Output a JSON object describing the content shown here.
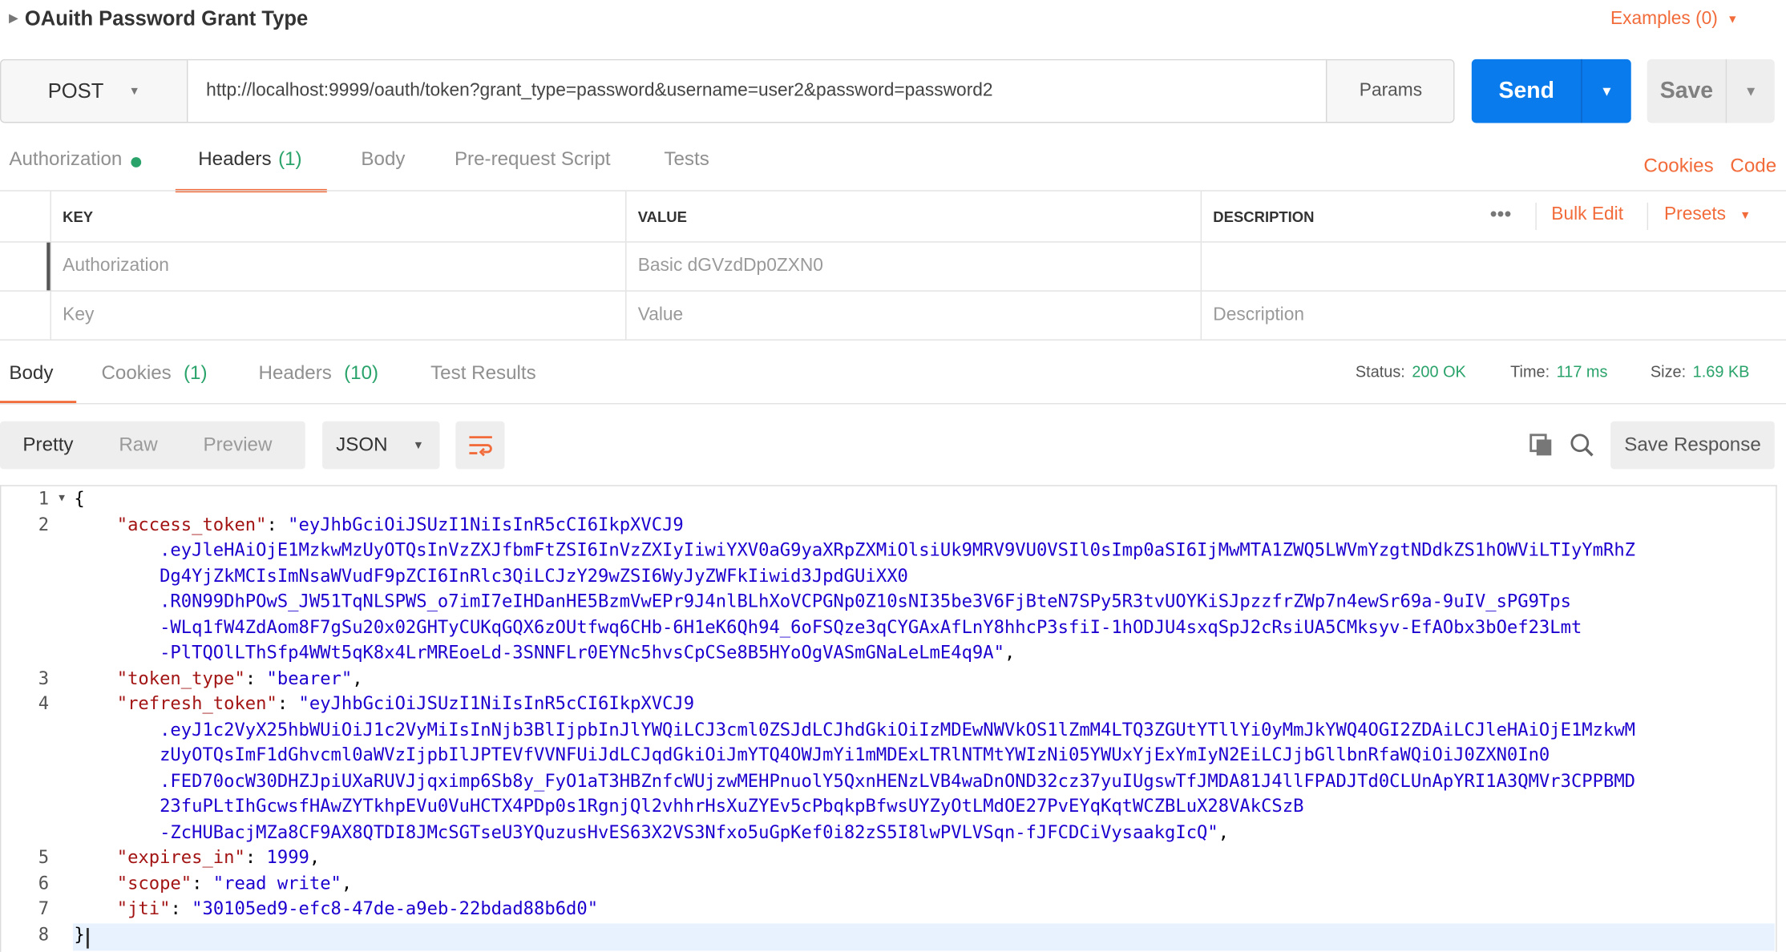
{
  "request": {
    "title": "OAuith Password Grant Type",
    "examples_label": "Examples (0)",
    "method": "POST",
    "url": "http://localhost:9999/oauth/token?grant_type=password&username=user2&password=password2",
    "params_label": "Params",
    "send_label": "Send",
    "save_label": "Save"
  },
  "request_tabs": {
    "authorization": "Authorization",
    "headers": "Headers",
    "headers_count": "(1)",
    "body": "Body",
    "prerequest": "Pre-request Script",
    "tests": "Tests",
    "cookies": "Cookies",
    "code": "Code"
  },
  "headers_table": {
    "col_key": "KEY",
    "col_value": "VALUE",
    "col_description": "DESCRIPTION",
    "bulk_edit": "Bulk Edit",
    "presets": "Presets",
    "more": "•••",
    "rows": [
      {
        "key": "Authorization",
        "value": "Basic dGVzdDp0ZXN0",
        "description": ""
      }
    ],
    "placeholder": {
      "key": "Key",
      "value": "Value",
      "description": "Description"
    }
  },
  "response_tabs": {
    "body": "Body",
    "cookies": "Cookies",
    "cookies_count": "(1)",
    "headers": "Headers",
    "headers_count": "(10)",
    "test_results": "Test Results"
  },
  "response_meta": {
    "status_label": "Status:",
    "status": "200 OK",
    "time_label": "Time:",
    "time": "117 ms",
    "size_label": "Size:",
    "size": "1.69 KB"
  },
  "view": {
    "pretty": "Pretty",
    "raw": "Raw",
    "preview": "Preview",
    "format": "JSON",
    "save_response": "Save Response"
  },
  "code": {
    "line_numbers": [
      "1",
      "2",
      "",
      "",
      "",
      "",
      "",
      "3",
      "4",
      "",
      "",
      "",
      "",
      "",
      "5",
      "6",
      "7",
      "8"
    ],
    "lines": [
      {
        "t": "{"
      },
      {
        "k": "\"access_token\"",
        "p": ": ",
        "s": "\"eyJhbGciOiJSUzI1NiIsInR5cCI6IkpXVCJ9",
        "indent": "    "
      },
      {
        "s": ".eyJleHAiOjE1MzkwMzUyOTQsInVzZXJfbmFtZSI6InVzZXIyIiwiYXV0aG9yaXRpZXMiOlsiUk9MRV9VU0VSIl0sImp0aSI6IjMwMTA1ZWQ5LWVmYzgtNDdkZS1hOWViLTIyYmRhZ",
        "indent": "        "
      },
      {
        "s": "Dg4YjZkMCIsImNsaWVudF9pZCI6InRlc3QiLCJzY29wZSI6WyJyZWFkIiwid3JpdGUiXX0",
        "indent": "        "
      },
      {
        "s": ".R0N99DhPOwS_JW51TqNLSPWS_o7imI7eIHDanHE5BzmVwEPr9J4nlBLhXoVCPGNp0Z10sNI35be3V6FjBteN7SPy5R3tvUOYKiSJpzzfrZWp7n4ewSr69a-9uIV_sPG9Tps",
        "indent": "        "
      },
      {
        "s": "-WLq1fW4ZdAom8F7gSu20x02GHTyCUKqGQX6zOUtfwq6CHb-6H1eK6Qh94_6oFSQze3qCYGAxAfLnY8hhcP3sfiI-1hODJU4sxqSpJ2cRsiUA5CMksyv-EfAObx3bOef23Lmt",
        "indent": "        "
      },
      {
        "s": "-PlTQOlLThSfp4WWt5qK8x4LrMREoeLd-3SNNFLr0EYNc5hvsCpCSe8B5HYoOgVASmGNaLeLmE4q9A\"",
        "p": ",",
        "indent": "        "
      },
      {
        "k": "\"token_type\"",
        "p": ": ",
        "s": "\"bearer\"",
        "p2": ",",
        "indent": "    "
      },
      {
        "k": "\"refresh_token\"",
        "p": ": ",
        "s": "\"eyJhbGciOiJSUzI1NiIsInR5cCI6IkpXVCJ9",
        "indent": "    "
      },
      {
        "s": ".eyJ1c2VyX25hbWUiOiJ1c2VyMiIsInNjb3BlIjpbInJlYWQiLCJ3cml0ZSJdLCJhdGkiOiIzMDEwNWVkOS1lZmM4LTQ3ZGUtYTllYi0yMmJkYWQ4OGI2ZDAiLCJleHAiOjE1MzkwM",
        "indent": "        "
      },
      {
        "s": "zUyOTQsImF1dGhvcml0aWVzIjpbIlJPTEVfVVNFUiJdLCJqdGkiOiJmYTQ4OWJmYi1mMDExLTRlNTMtYWIzNi05YWUxYjExYmIyN2EiLCJjbGllbnRfaWQiOiJ0ZXN0In0",
        "indent": "        "
      },
      {
        "s": ".FED70ocW30DHZJpiUXaRUVJjqximp6Sb8y_FyO1aT3HBZnfcWUjzwMEHPnuolY5QxnHENzLVB4waDnOND32cz37yuIUgswTfJMDA81J4llFPADJTd0CLUnApYRI1A3QMVr3CPPBMD",
        "indent": "        "
      },
      {
        "s": "23fuPLtIhGcwsfHAwZYTkhpEVu0VuHCTX4PDp0s1RgnjQl2vhhrHsXuZYEv5cPbqkpBfwsUYZyOtLMdOE27PvEYqKqtWCZBLuX28VAkCSzB",
        "indent": "        "
      },
      {
        "s": "-ZcHUBacjMZa8CF9AX8QTDI8JMcSGTseU3YQuzusHvES63X2VS3Nfxo5uGpKef0i82zS5I8lwPVLVSqn-fJFCDCiVysaakgIcQ\"",
        "p": ",",
        "indent": "        "
      },
      {
        "k": "\"expires_in\"",
        "p": ": ",
        "n": "1999",
        "p2": ",",
        "indent": "    "
      },
      {
        "k": "\"scope\"",
        "p": ": ",
        "s": "\"read write\"",
        "p2": ",",
        "indent": "    "
      },
      {
        "k": "\"jti\"",
        "p": ": ",
        "s": "\"30105ed9-efc8-47de-a9eb-22bdad88b6d0\"",
        "indent": "    "
      },
      {
        "t": "}"
      }
    ]
  },
  "icons": [
    "caret-right-icon",
    "chevron-down-icon",
    "wrap-lines-icon",
    "copy-icon",
    "search-icon"
  ],
  "colors": {
    "accent": "#f26b3a",
    "send": "#097bed",
    "success": "#2aa36b",
    "string": "#1c00cf",
    "key": "#a31515"
  }
}
